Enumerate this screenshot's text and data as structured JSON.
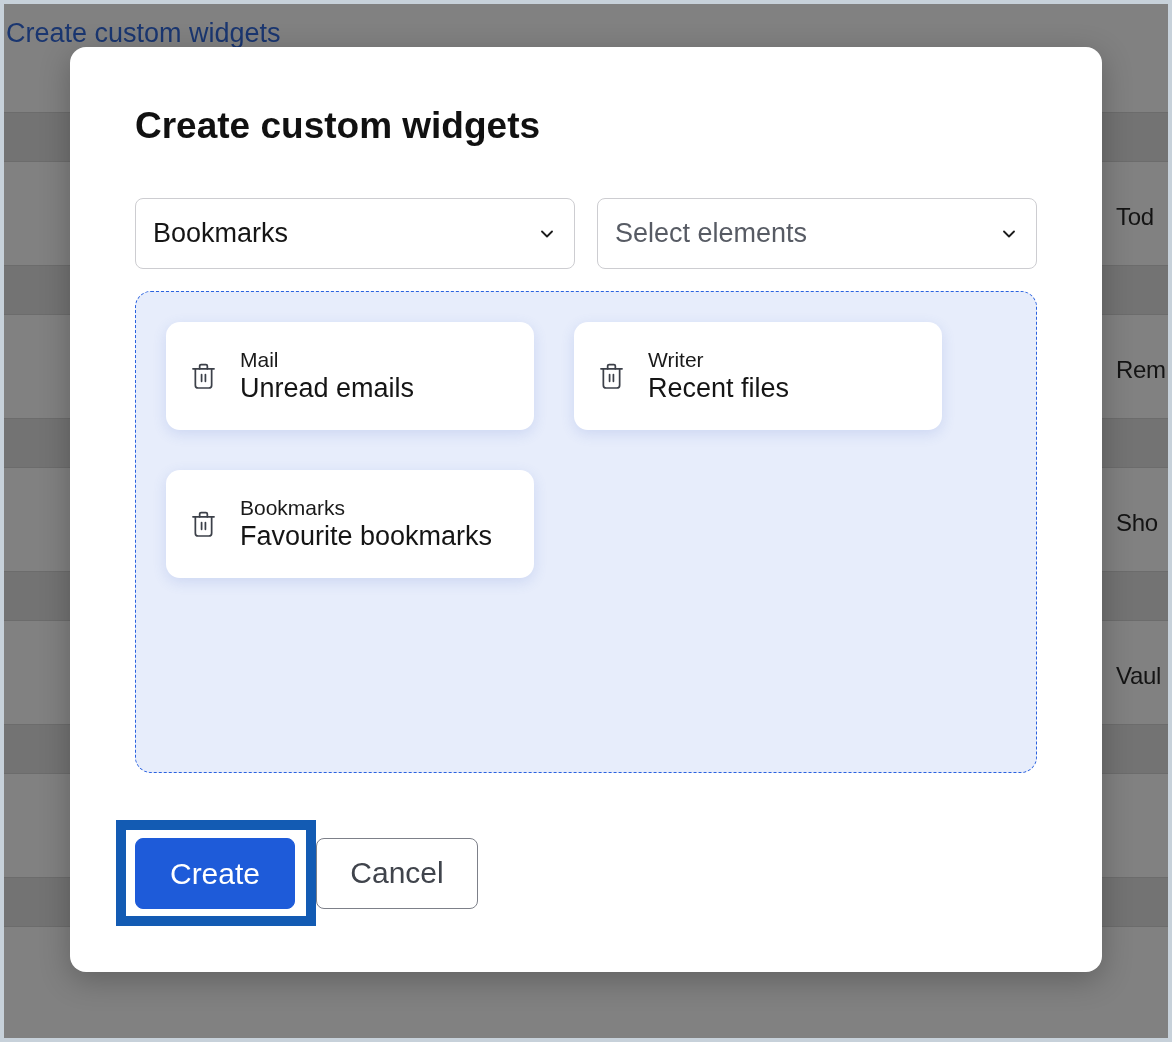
{
  "background": {
    "link": "Create custom widgets",
    "rows": [
      {
        "label": "Tod"
      },
      {
        "label": "Rem"
      },
      {
        "label": "Sho"
      },
      {
        "label": "Vaul"
      }
    ]
  },
  "dialog": {
    "title": "Create custom widgets",
    "selects": [
      {
        "value": "Bookmarks"
      },
      {
        "placeholder": "Select elements"
      }
    ],
    "widgets": [
      {
        "app": "Mail",
        "name": "Unread emails"
      },
      {
        "app": "Writer",
        "name": "Recent files"
      },
      {
        "app": "Bookmarks",
        "name": "Favourite bookmarks"
      }
    ],
    "buttons": [
      {
        "label": "Create",
        "kind": "primary",
        "highlighted": true
      },
      {
        "label": "Cancel",
        "kind": "secondary",
        "highlighted": false
      }
    ]
  }
}
